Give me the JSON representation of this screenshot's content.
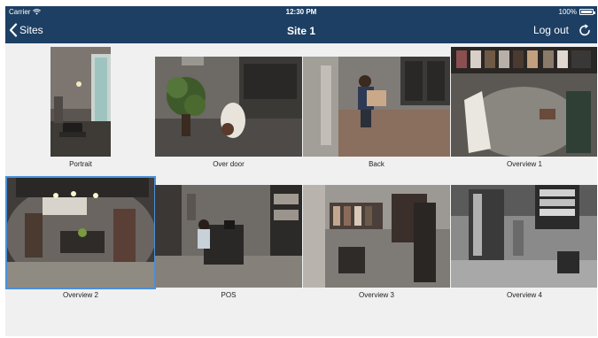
{
  "status": {
    "carrier": "Carrier",
    "time": "12:30 PM",
    "battery": "100%",
    "battery_level": 1.0
  },
  "nav": {
    "back_label": "Sites",
    "title": "Site 1",
    "logout_label": "Log out"
  },
  "cameras": [
    {
      "name": "Portrait"
    },
    {
      "name": "Over door"
    },
    {
      "name": "Back"
    },
    {
      "name": "Overview 1"
    },
    {
      "name": "Overview 2"
    },
    {
      "name": "POS"
    },
    {
      "name": "Overview 3"
    },
    {
      "name": "Overview 4"
    }
  ],
  "colors": {
    "bar_bg": "#1d3f63",
    "page_bg": "#f0f0f0",
    "selected_border": "#4a90d9"
  },
  "selected_camera": "Overview 2"
}
